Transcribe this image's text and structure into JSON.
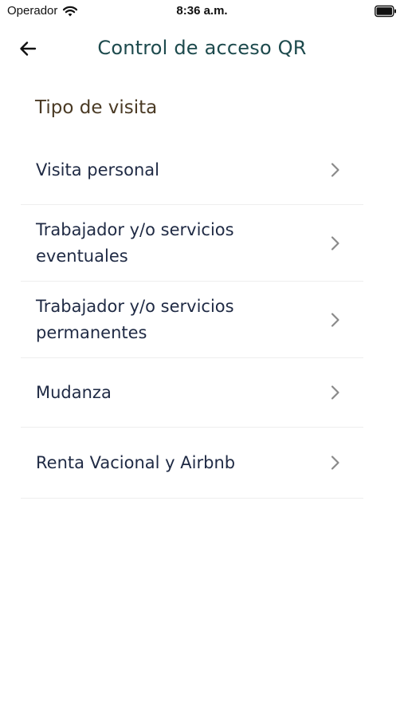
{
  "status_bar": {
    "carrier": "Operador",
    "time": "8:36 a.m."
  },
  "nav": {
    "title": "Control de acceso QR"
  },
  "section": {
    "title": "Tipo de visita"
  },
  "options": [
    {
      "label": "Visita personal"
    },
    {
      "label": "Trabajador y/o servicios\neventuales"
    },
    {
      "label": "Trabajador y/o servicios\npermanentes"
    },
    {
      "label": "Mudanza"
    },
    {
      "label": "Renta Vacional y Airbnb"
    }
  ],
  "colors": {
    "title": "#1d4a4d",
    "section": "#4a3a24",
    "item_text": "#1f2a44",
    "chevron": "#8a8a8a",
    "divider": "#eeeeee"
  }
}
